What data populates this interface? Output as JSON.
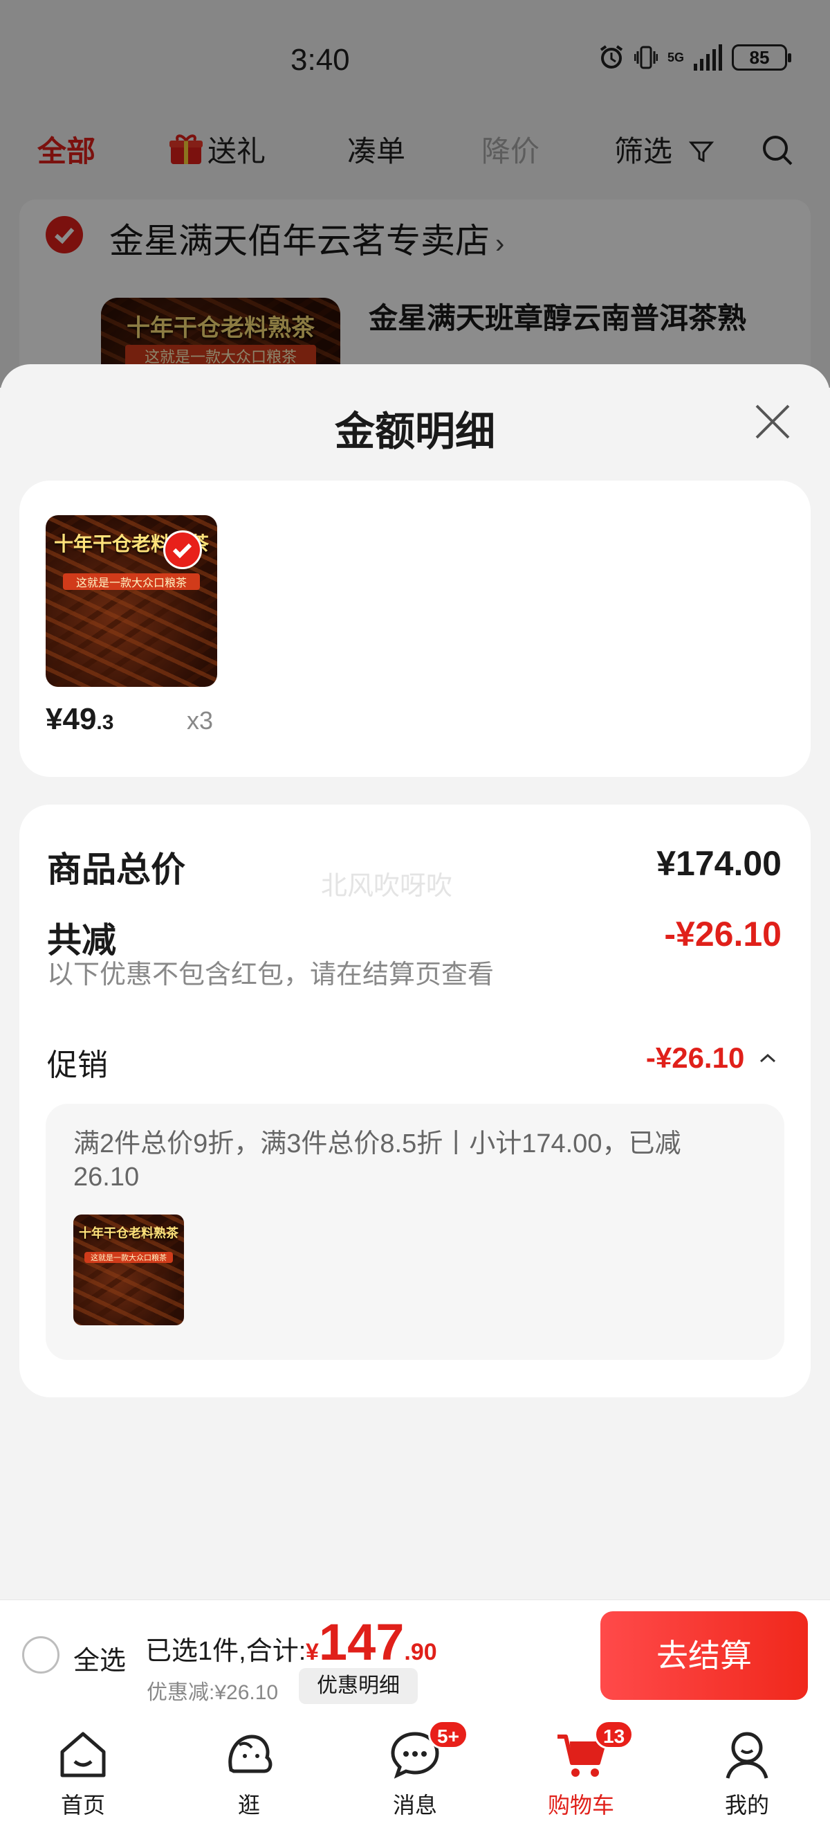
{
  "status_bar": {
    "time": "3:40",
    "network": "5G",
    "battery": "85"
  },
  "filter_tabs": [
    {
      "label": "全部",
      "state": "active"
    },
    {
      "label": "送礼",
      "state": "normal",
      "icon": "gift-icon"
    },
    {
      "label": "凑单",
      "state": "normal"
    },
    {
      "label": "降价",
      "state": "muted"
    },
    {
      "label": "筛选",
      "state": "normal",
      "icon": "filter-icon"
    }
  ],
  "store": {
    "name": "金星满天佰年云茗专卖店",
    "chevron": "›",
    "product_title": "金星满天班章醇云南普洱茶熟"
  },
  "product_image_text": {
    "title": "十年干仓老料熟茶",
    "subtitle": "这就是一款大众口粮茶"
  },
  "sheet": {
    "title": "金额明细",
    "item": {
      "price_main": "¥49",
      "price_decimal": ".3",
      "quantity": "x3"
    },
    "summary": {
      "total_label": "商品总价",
      "total_value": "¥174.00",
      "watermark": "北风吹呀吹",
      "reduce_label": "共减",
      "reduce_value": "-¥26.10",
      "reduce_note": "以下优惠不包含红包，请在结算页查看",
      "promo_label": "促销",
      "promo_value": "-¥26.10",
      "promo_detail": "满2件总价9折，满3件总价8.5折丨小计174.00，已减26.10"
    }
  },
  "checkout": {
    "select_all": "全选",
    "selected_text": "已选1件,合计:",
    "currency": "¥",
    "total_int": "147",
    "total_dec": ".90",
    "discount_text": "优惠减:¥26.10",
    "detail_button": "优惠明细",
    "checkout_button": "去结算"
  },
  "bottom_nav": [
    {
      "label": "首页",
      "icon": "home-icon"
    },
    {
      "label": "逛",
      "icon": "browse-icon"
    },
    {
      "label": "消息",
      "icon": "message-icon",
      "badge": "5+"
    },
    {
      "label": "购物车",
      "icon": "cart-icon",
      "badge": "13",
      "active": true
    },
    {
      "label": "我的",
      "icon": "profile-icon"
    }
  ],
  "colors": {
    "accent": "#e0201a",
    "sheet_bg": "#f3f3f3",
    "card_bg": "#ffffff"
  }
}
